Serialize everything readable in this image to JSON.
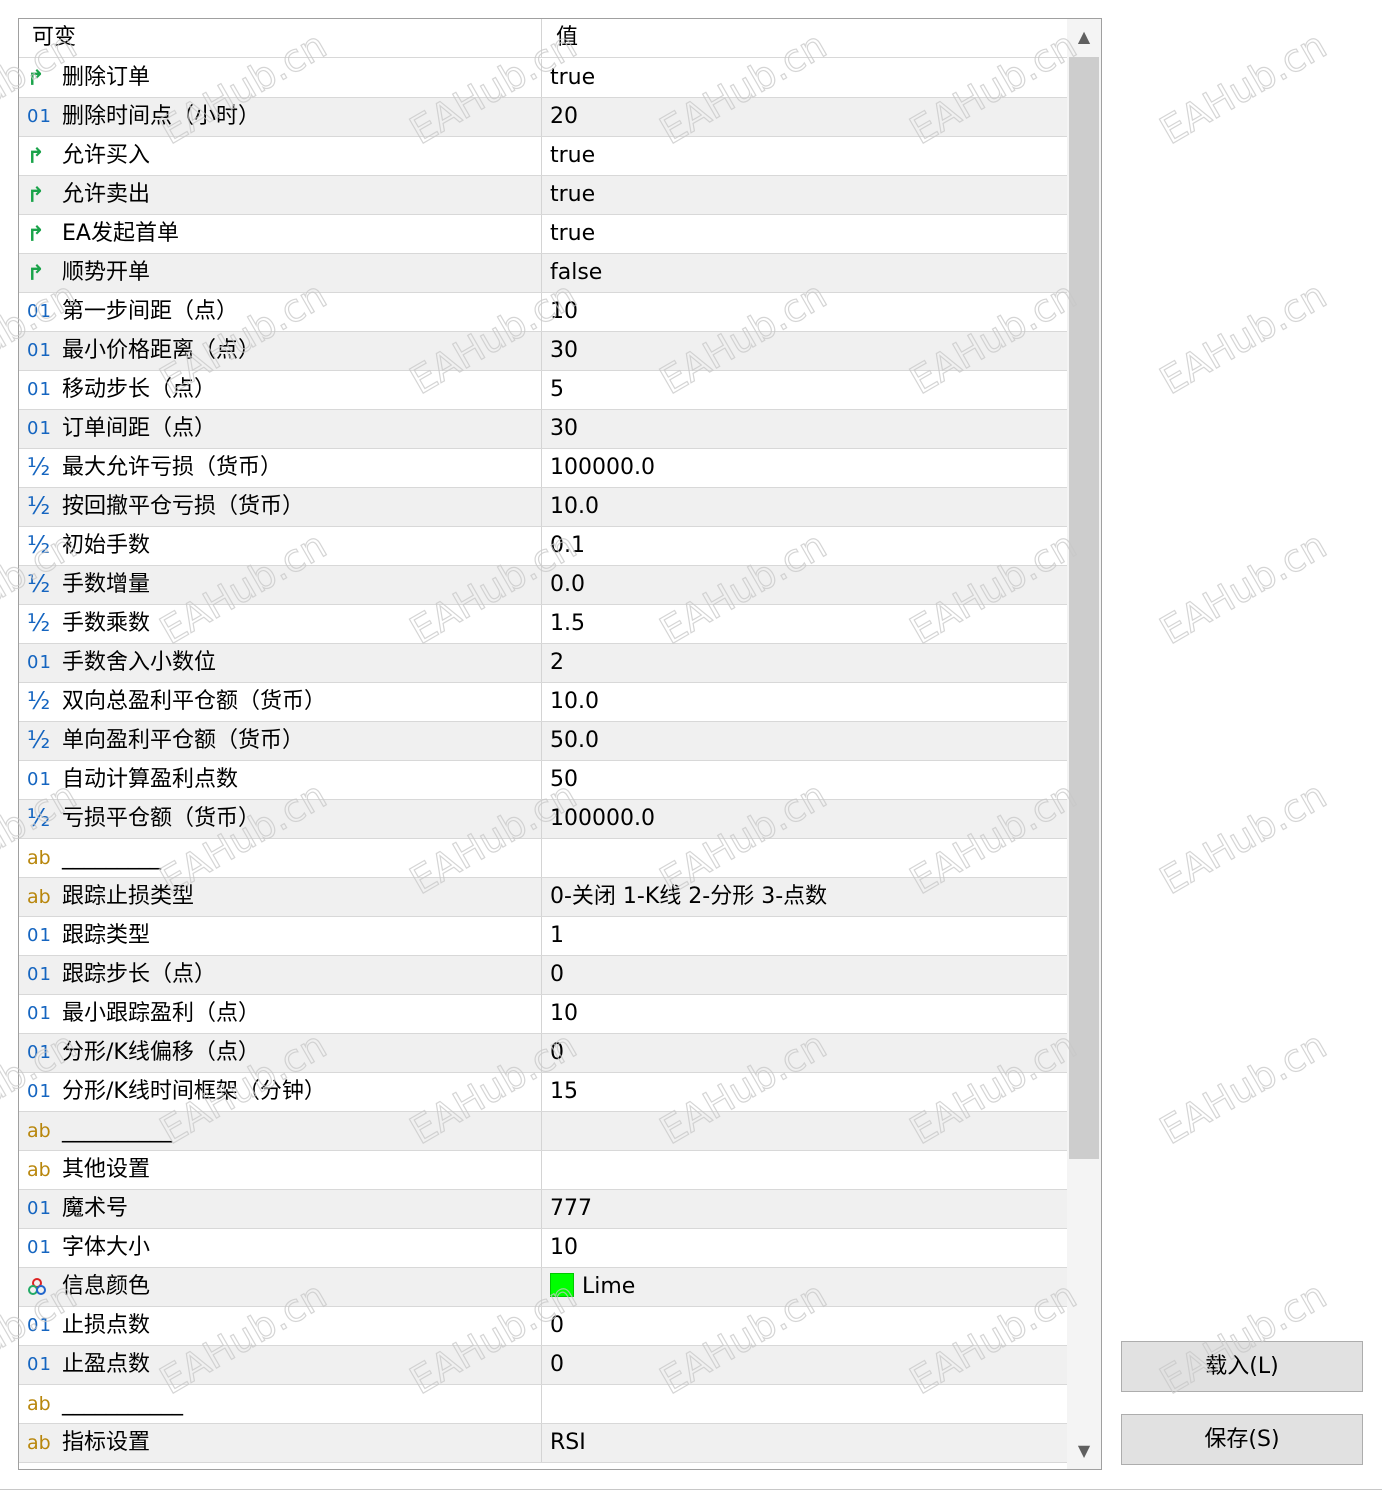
{
  "table": {
    "header": {
      "name": "可变",
      "value": "值"
    },
    "rows": [
      {
        "type": "bool",
        "name": "删除订单",
        "value": "true"
      },
      {
        "type": "int",
        "name": "删除时间点（小时）",
        "value": "20"
      },
      {
        "type": "bool",
        "name": "允许买入",
        "value": "true"
      },
      {
        "type": "bool",
        "name": "允许卖出",
        "value": "true"
      },
      {
        "type": "bool",
        "name": "EA发起首单",
        "value": "true"
      },
      {
        "type": "bool",
        "name": "顺势开单",
        "value": "false"
      },
      {
        "type": "int",
        "name": "第一步间距（点）",
        "value": "10"
      },
      {
        "type": "int",
        "name": "最小价格距离（点）",
        "value": "30"
      },
      {
        "type": "int",
        "name": "移动步长（点）",
        "value": "5"
      },
      {
        "type": "int",
        "name": "订单间距（点）",
        "value": "30"
      },
      {
        "type": "double",
        "name": "最大允许亏损（货币）",
        "value": "100000.0"
      },
      {
        "type": "double",
        "name": "按回撤平仓亏损（货币）",
        "value": "10.0"
      },
      {
        "type": "double",
        "name": "初始手数",
        "value": "0.1"
      },
      {
        "type": "double",
        "name": "手数增量",
        "value": "0.0"
      },
      {
        "type": "double",
        "name": "手数乘数",
        "value": "1.5"
      },
      {
        "type": "int",
        "name": "手数舍入小数位",
        "value": "2"
      },
      {
        "type": "double",
        "name": "双向总盈利平仓额（货币）",
        "value": "10.0"
      },
      {
        "type": "double",
        "name": "单向盈利平仓额（货币）",
        "value": "50.0"
      },
      {
        "type": "int",
        "name": "自动计算盈利点数",
        "value": "50"
      },
      {
        "type": "double",
        "name": "亏损平仓额（货币）",
        "value": "100000.0"
      },
      {
        "type": "string",
        "name": "_________",
        "value": ""
      },
      {
        "type": "string",
        "name": "跟踪止损类型",
        "value": "0-关闭  1-K线  2-分形  3-点数"
      },
      {
        "type": "int",
        "name": "跟踪类型",
        "value": "1"
      },
      {
        "type": "int",
        "name": "跟踪步长（点）",
        "value": "0"
      },
      {
        "type": "int",
        "name": "最小跟踪盈利（点）",
        "value": "10"
      },
      {
        "type": "int",
        "name": "分形/K线偏移（点）",
        "value": "0"
      },
      {
        "type": "int",
        "name": "分形/K线时间框架（分钟）",
        "value": "15"
      },
      {
        "type": "string",
        "name": "__________",
        "value": ""
      },
      {
        "type": "string",
        "name": "其他设置",
        "value": ""
      },
      {
        "type": "int",
        "name": "魔术号",
        "value": "777"
      },
      {
        "type": "int",
        "name": "字体大小",
        "value": "10"
      },
      {
        "type": "color",
        "name": "信息颜色",
        "value": "Lime",
        "swatch": "#00ff00"
      },
      {
        "type": "int",
        "name": "止损点数",
        "value": "0"
      },
      {
        "type": "int",
        "name": "止盈点数",
        "value": "0"
      },
      {
        "type": "string",
        "name": "___________",
        "value": ""
      },
      {
        "type": "string",
        "name": "指标设置",
        "value": "RSI"
      }
    ]
  },
  "icons": {
    "bool": "↱",
    "int": "01",
    "double": "½",
    "string": "ab",
    "color": "color-palette-icon"
  },
  "scrollbar": {
    "up": "▲",
    "down": "▼"
  },
  "buttons": {
    "load": "载入(L)",
    "save": "保存(S)"
  },
  "watermark": "EAHub.cn",
  "colors": {
    "bool_icon": "#1aa34a",
    "number_icon": "#1565c0",
    "string_icon": "#b8860b",
    "alt_row": "#f0f0f0"
  }
}
